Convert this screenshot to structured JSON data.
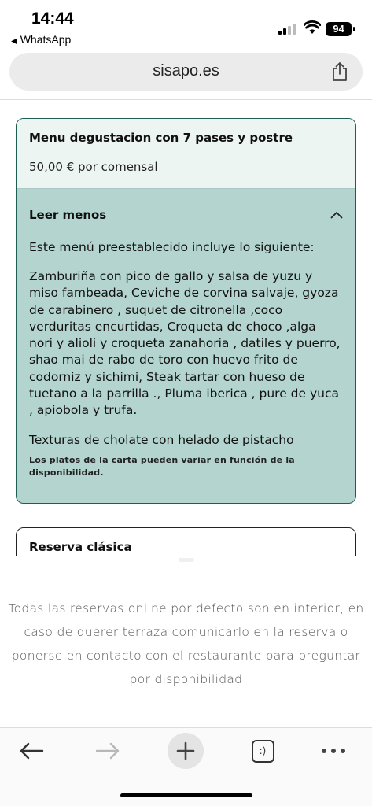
{
  "status_bar": {
    "time": "14:44",
    "back_app": "WhatsApp",
    "battery": "94"
  },
  "browser": {
    "url": "sisapo.es",
    "share_icon": "share-icon",
    "tabs_label": ":)"
  },
  "menu_card": {
    "title": "Menu degustacion con 7 pases y postre",
    "price": "50,00 € por comensal",
    "toggle_label": "Leer menos",
    "intro": "Este menú preestablecido incluye lo siguiente:",
    "dishes": "Zamburiña con pico de gallo y salsa de yuzu y miso fambeada, Ceviche de corvina salvaje, gyoza de carabinero , suquet de citronella ,coco verduritas encurtidas, Croqueta de choco ,alga nori y alioli y croqueta zanahoria , datiles y puerro, shao mai de rabo de toro con huevo frito de codorniz y sichimi, Steak tartar con hueso de tuetano a la parrilla ., Pluma iberica , pure de yuca , apiobola y trufa.",
    "dessert": "Texturas de cholate con helado de pistacho",
    "note": "Los platos de la carta pueden variar en función de la disponibilidad."
  },
  "reserva_card": {
    "title": "Reserva clásica"
  },
  "info_text": "Todas las reservas online por defecto son en interior, en caso de querer terraza comunicarlo en la reserva o ponerse en contacto con el restaurante para preguntar por disponibilidad",
  "colors": {
    "card_body": "#b4d5cf",
    "card_head": "#edf5f3",
    "card_border": "#1f5e52"
  }
}
